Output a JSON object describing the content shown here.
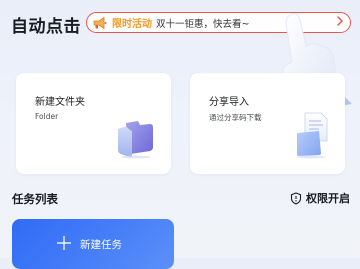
{
  "header": {
    "title": "自动点击"
  },
  "promo": {
    "tag": "限时活动",
    "text": "双十一钜惠，快去看~"
  },
  "cards": {
    "new_folder": {
      "title": "新建文件夹",
      "subtitle": "Folder"
    },
    "share_import": {
      "title": "分享导入",
      "subtitle": "通过分享码下载"
    }
  },
  "task_section": {
    "title": "任务列表",
    "permission_label": "权限开启"
  },
  "new_task": {
    "label": "新建任务"
  },
  "colors": {
    "accent": "#2f6bf6",
    "promo_border": "#e8574a",
    "promo_tag": "#f29a2a"
  }
}
